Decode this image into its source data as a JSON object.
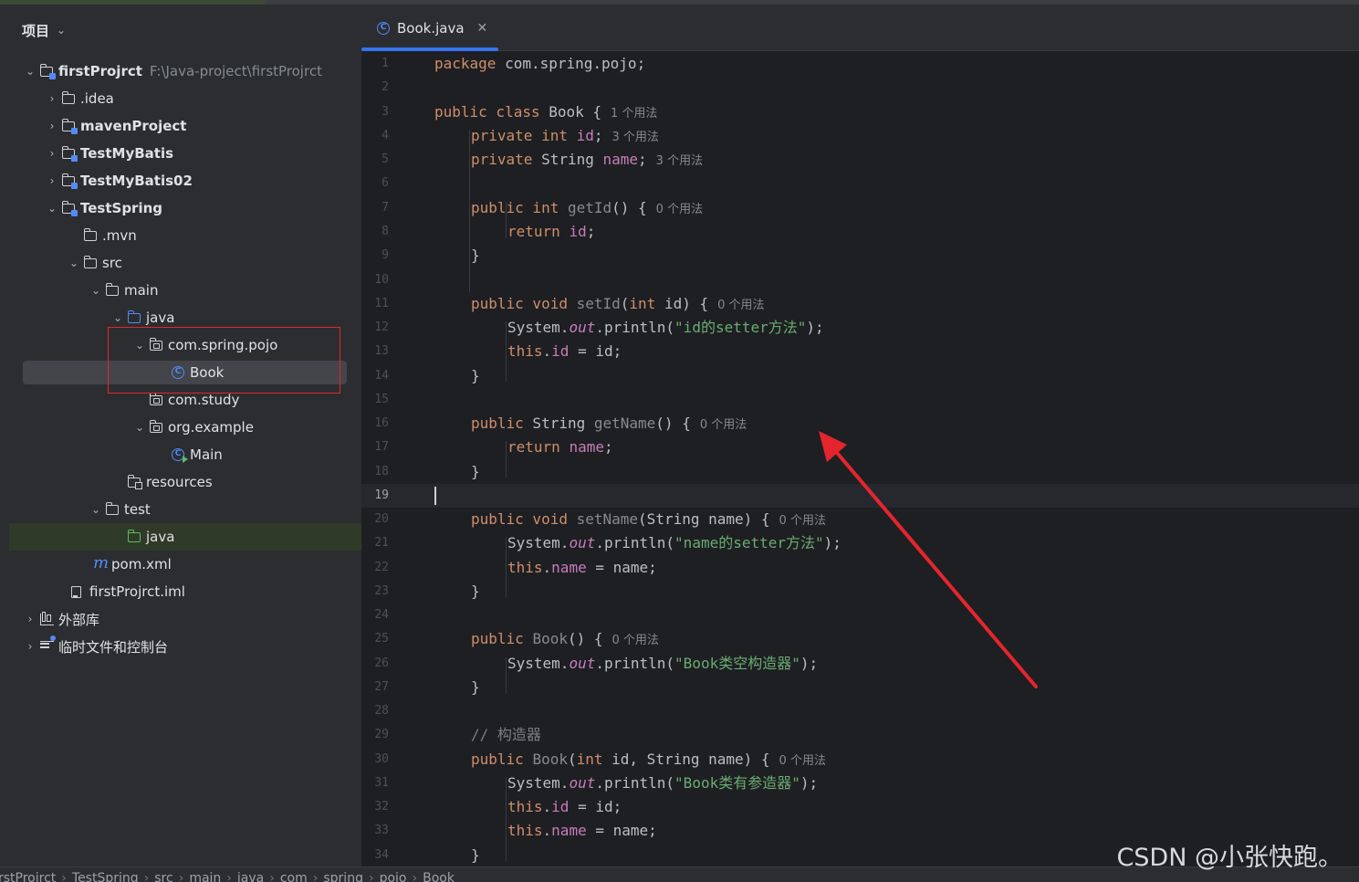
{
  "project_panel": {
    "title": "项目",
    "tree": [
      {
        "label": "firstProjrct",
        "path": "F:\\Java-project\\firstProjrct",
        "bold": true
      },
      {
        "label": ".idea"
      },
      {
        "label": "mavenProject",
        "bold": true
      },
      {
        "label": "TestMyBatis",
        "bold": true
      },
      {
        "label": "TestMyBatis02",
        "bold": true
      },
      {
        "label": "TestSpring",
        "bold": true
      },
      {
        "label": ".mvn"
      },
      {
        "label": "src"
      },
      {
        "label": "main"
      },
      {
        "label": "java"
      },
      {
        "label": "com.spring.pojo"
      },
      {
        "label": "Book"
      },
      {
        "label": "com.study"
      },
      {
        "label": "org.example"
      },
      {
        "label": "Main"
      },
      {
        "label": "resources"
      },
      {
        "label": "test"
      },
      {
        "label": "java"
      },
      {
        "label": "pom.xml"
      },
      {
        "label": "firstProjrct.iml"
      },
      {
        "label": "外部库"
      },
      {
        "label": "临时文件和控制台"
      }
    ]
  },
  "editor": {
    "tab_label": "Book.java",
    "current_line": 19,
    "line_numbers": [
      "1",
      "2",
      "3",
      "4",
      "5",
      "6",
      "7",
      "8",
      "9",
      "10",
      "11",
      "12",
      "13",
      "14",
      "15",
      "16",
      "17",
      "18",
      "19",
      "20",
      "21",
      "22",
      "23",
      "24",
      "25",
      "26",
      "27",
      "28",
      "29",
      "30",
      "31",
      "32",
      "33",
      "34"
    ],
    "code": {
      "l1_kw": "package",
      "l1_rest": " com.spring.pojo;",
      "l3_kw": "public class",
      "l3_name": " Book {",
      "l3_hint": "1 个用法",
      "l4_kw": "private int",
      "l4_field": "id",
      "l4_end": ";",
      "l4_hint": "3 个用法",
      "l5_kw": "private",
      "l5_type": " String ",
      "l5_field": "name",
      "l5_end": ";",
      "l5_hint": "3 个用法",
      "l7_kw": "public int",
      "l7_method": "getId",
      "l7_rest": "() {",
      "l7_hint": "0 个用法",
      "l8_kw": "return",
      "l8_field": "id",
      "l8_end": ";",
      "close": "}",
      "l11_kw": "public void",
      "l11_method": "setId",
      "l11_p1": "(",
      "l11_pkw": "int",
      "l11_p2": " id) {",
      "l11_hint": "0 个用法",
      "l12_a": "System.",
      "l12_out": "out",
      "l12_b": ".println(",
      "l12_str": "\"id的setter方法\"",
      "l12_c": ");",
      "l13_kw": "this",
      "l13_dot": ".",
      "l13_field": "id",
      "l13_rest": " = id;",
      "l16_kw": "public",
      "l16_type": " String ",
      "l16_method": "getName",
      "l16_rest": "() {",
      "l16_hint": "0 个用法",
      "l17_kw": "return",
      "l17_field": "name",
      "l17_end": ";",
      "l20_kw": "public void",
      "l20_method": "setName",
      "l20_rest": "(String name) {",
      "l20_hint": "0 个用法",
      "l21_a": "System.",
      "l21_out": "out",
      "l21_b": ".println(",
      "l21_str": "\"name的setter方法\"",
      "l21_c": ");",
      "l22_kw": "this",
      "l22_dot": ".",
      "l22_field": "name",
      "l22_rest": " = name;",
      "l25_kw": "public",
      "l25_method": "Book",
      "l25_rest": "() {",
      "l25_hint": "0 个用法",
      "l26_a": "System.",
      "l26_out": "out",
      "l26_b": ".println(",
      "l26_str": "\"Book类空构造器\"",
      "l26_c": ");",
      "l29_comment": "// 构造器",
      "l30_kw": "public",
      "l30_method": "Book",
      "l30_p1": "(",
      "l30_pkw": "int",
      "l30_p2": " id, String name) {",
      "l30_hint": "0 个用法",
      "l31_a": "System.",
      "l31_out": "out",
      "l31_b": ".println(",
      "l31_str": "\"Book类有参造器\"",
      "l31_c": ");",
      "l32_kw": "this",
      "l32_dot": ".",
      "l32_field": "id",
      "l32_rest": " = id;",
      "l33_kw": "this",
      "l33_dot": ".",
      "l33_field": "name",
      "l33_rest": " = name;"
    }
  },
  "breadcrumbs": [
    "rstProjrct",
    "TestSpring",
    "src",
    "main",
    "java",
    "com",
    "spring",
    "pojo",
    "Book"
  ],
  "watermark": "CSDN @小张快跑。",
  "colors": {
    "annotation_red": "#e5252e",
    "accent_blue": "#3574f0",
    "keyword": "#cf8e6d",
    "string": "#6aab73",
    "field": "#c77dbb"
  }
}
